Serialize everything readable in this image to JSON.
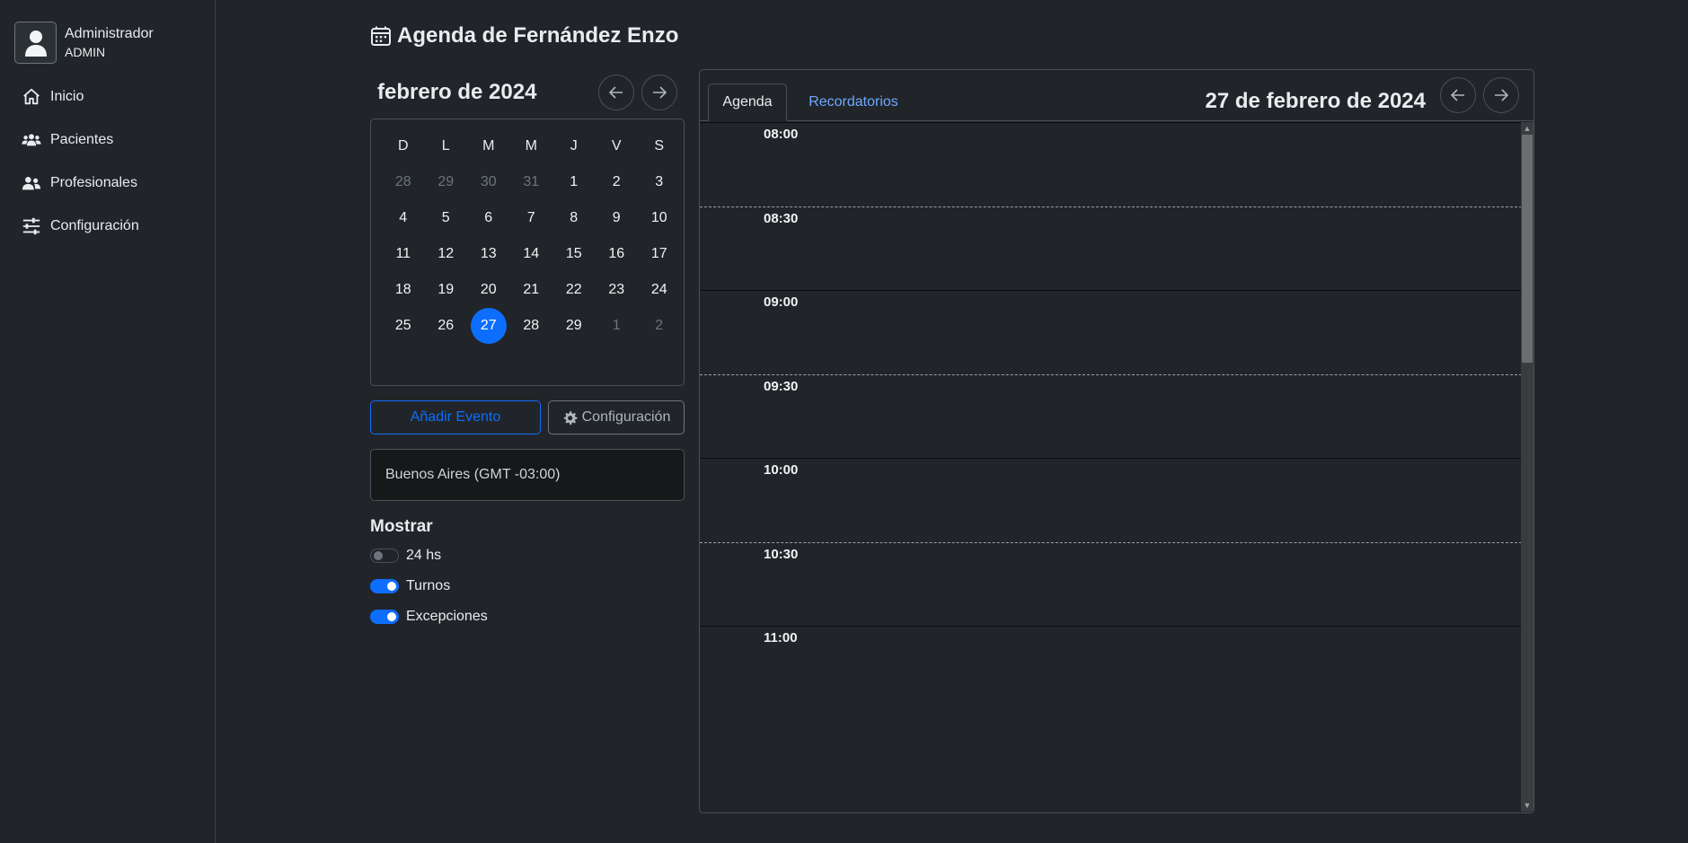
{
  "user": {
    "name": "Administrador",
    "role": "ADMIN"
  },
  "nav": [
    {
      "label": "Inicio",
      "icon": "home-icon"
    },
    {
      "label": "Pacientes",
      "icon": "users-icon"
    },
    {
      "label": "Profesionales",
      "icon": "user-group-icon"
    },
    {
      "label": "Configuración",
      "icon": "sliders-icon"
    }
  ],
  "page_title": "Agenda de Fernández Enzo",
  "mini_calendar": {
    "month_label": "febrero de 2024",
    "weekdays": [
      "D",
      "L",
      "M",
      "M",
      "J",
      "V",
      "S"
    ],
    "weeks": [
      [
        {
          "d": "28",
          "m": true
        },
        {
          "d": "29",
          "m": true
        },
        {
          "d": "30",
          "m": true
        },
        {
          "d": "31",
          "m": true
        },
        {
          "d": "1"
        },
        {
          "d": "2"
        },
        {
          "d": "3"
        }
      ],
      [
        {
          "d": "4"
        },
        {
          "d": "5"
        },
        {
          "d": "6"
        },
        {
          "d": "7"
        },
        {
          "d": "8"
        },
        {
          "d": "9"
        },
        {
          "d": "10"
        }
      ],
      [
        {
          "d": "11"
        },
        {
          "d": "12"
        },
        {
          "d": "13"
        },
        {
          "d": "14"
        },
        {
          "d": "15"
        },
        {
          "d": "16"
        },
        {
          "d": "17"
        }
      ],
      [
        {
          "d": "18"
        },
        {
          "d": "19"
        },
        {
          "d": "20"
        },
        {
          "d": "21"
        },
        {
          "d": "22"
        },
        {
          "d": "23"
        },
        {
          "d": "24"
        }
      ],
      [
        {
          "d": "25"
        },
        {
          "d": "26"
        },
        {
          "d": "27",
          "s": true
        },
        {
          "d": "28"
        },
        {
          "d": "29"
        },
        {
          "d": "1",
          "m": true
        },
        {
          "d": "2",
          "m": true
        }
      ]
    ]
  },
  "buttons": {
    "add_event": "Añadir Evento",
    "config": "Configuración"
  },
  "timezone": "Buenos Aires (GMT -03:00)",
  "show": {
    "title": "Mostrar",
    "toggles": [
      {
        "label": "24 hs",
        "on": false
      },
      {
        "label": "Turnos",
        "on": true
      },
      {
        "label": "Excepciones",
        "on": true
      }
    ]
  },
  "agenda": {
    "tabs": {
      "agenda": "Agenda",
      "reminders": "Recordatorios"
    },
    "date_label": "27 de febrero de 2024",
    "slots": [
      "08:00",
      "08:30",
      "09:00",
      "09:30",
      "10:00",
      "10:30",
      "11:00"
    ]
  },
  "colors": {
    "accent": "#0d6efd",
    "background": "#212529",
    "link": "#6ea8fe"
  }
}
